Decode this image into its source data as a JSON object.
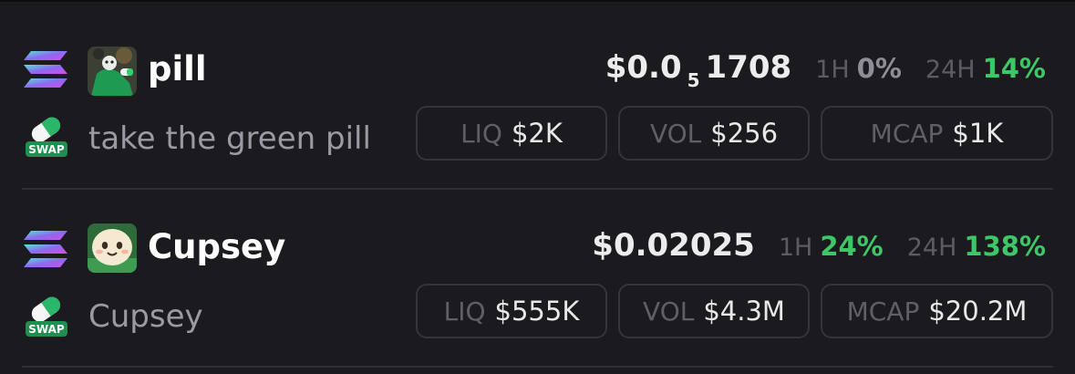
{
  "tokens": [
    {
      "chain_icon": "solana-icon",
      "avatar": "pill-avatar",
      "name": "pill",
      "platform_icon": "swap-pill-badge",
      "platform_label": "SWAP",
      "description": "take the green pill",
      "price_main": "$0.0",
      "price_subscript": "5",
      "price_tail": "1708",
      "change_1h_label": "1H",
      "change_1h": "0%",
      "change_24h_label": "24H",
      "change_24h": "14%",
      "liq_label": "LIQ",
      "liq_value": "$2K",
      "vol_label": "VOL",
      "vol_value": "$256",
      "mcap_label": "MCAP",
      "mcap_value": "$1K"
    },
    {
      "chain_icon": "solana-icon",
      "avatar": "cupsey-avatar",
      "name": "Cupsey",
      "platform_icon": "swap-pill-badge",
      "platform_label": "SWAP",
      "description": "Cupsey",
      "price_main": "$0.02025",
      "change_1h_label": "1H",
      "change_1h": "24%",
      "change_24h_label": "24H",
      "change_24h": "138%",
      "liq_label": "LIQ",
      "liq_value": "$555K",
      "vol_label": "VOL",
      "vol_value": "$4.3M",
      "mcap_label": "MCAP",
      "mcap_value": "$20.2M"
    }
  ],
  "colors": {
    "background": "#1b1b1f",
    "positive": "#3ec767",
    "neutral": "#8e8e96",
    "muted_label": "#5b5b63",
    "border": "#34343a"
  }
}
